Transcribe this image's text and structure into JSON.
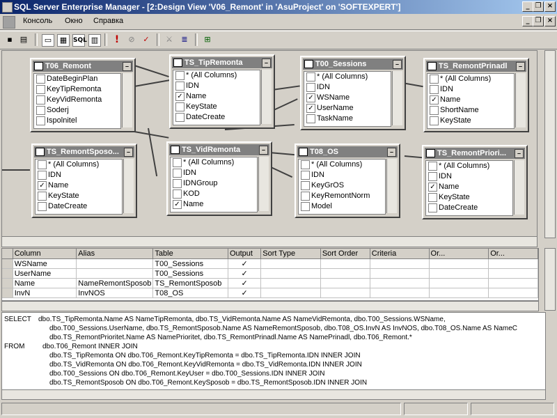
{
  "window": {
    "title": "SQL Server Enterprise Manager - [2:Design View 'V06_Remont' in 'AsuProject' on 'SOFTEXPERT']",
    "min_label": "_",
    "max_label": "❐",
    "close_label": "×"
  },
  "menu": {
    "items": [
      "Консоль",
      "Окно",
      "Справка"
    ]
  },
  "toolbar": {
    "sql_label": "SQL",
    "exclaim_label": "!"
  },
  "tables": [
    {
      "name": "T06_Remont",
      "rows": [
        {
          "label": "DateBeginPlan",
          "checked": false
        },
        {
          "label": "KeyTipRemonta",
          "checked": false
        },
        {
          "label": "KeyVidRemonta",
          "checked": false
        },
        {
          "label": "Soderj",
          "checked": false
        },
        {
          "label": "Ispolnitel",
          "checked": false
        }
      ]
    },
    {
      "name": "TS_TipRemonta",
      "rows": [
        {
          "label": "* (All Columns)",
          "checked": false
        },
        {
          "label": "IDN",
          "checked": false
        },
        {
          "label": "Name",
          "checked": true
        },
        {
          "label": "KeyState",
          "checked": false
        },
        {
          "label": "DateCreate",
          "checked": false
        }
      ]
    },
    {
      "name": "T00_Sessions",
      "rows": [
        {
          "label": "* (All Columns)",
          "checked": false
        },
        {
          "label": "IDN",
          "checked": false
        },
        {
          "label": "WSName",
          "checked": true
        },
        {
          "label": "UserName",
          "checked": true
        },
        {
          "label": "TaskName",
          "checked": false
        }
      ]
    },
    {
      "name": "TS_RemontPrinadl",
      "rows": [
        {
          "label": "* (All Columns)",
          "checked": false
        },
        {
          "label": "IDN",
          "checked": false
        },
        {
          "label": "Name",
          "checked": true
        },
        {
          "label": "ShortName",
          "checked": false
        },
        {
          "label": "KeyState",
          "checked": false
        }
      ]
    },
    {
      "name": "TS_RemontSposo...",
      "rows": [
        {
          "label": "* (All Columns)",
          "checked": false
        },
        {
          "label": "IDN",
          "checked": false
        },
        {
          "label": "Name",
          "checked": true
        },
        {
          "label": "KeyState",
          "checked": false
        },
        {
          "label": "DateCreate",
          "checked": false
        }
      ]
    },
    {
      "name": "TS_VidRemonta",
      "rows": [
        {
          "label": "* (All Columns)",
          "checked": false
        },
        {
          "label": "IDN",
          "checked": false
        },
        {
          "label": "IDNGroup",
          "checked": false
        },
        {
          "label": "KOD",
          "checked": false
        },
        {
          "label": "Name",
          "checked": true
        }
      ]
    },
    {
      "name": "T08_OS",
      "rows": [
        {
          "label": "* (All Columns)",
          "checked": false
        },
        {
          "label": "IDN",
          "checked": false
        },
        {
          "label": "KeyGrOS",
          "checked": false
        },
        {
          "label": "KeyRemontNorm",
          "checked": false
        },
        {
          "label": "Model",
          "checked": false
        }
      ]
    },
    {
      "name": "TS_RemontPriori...",
      "rows": [
        {
          "label": "* (All Columns)",
          "checked": false
        },
        {
          "label": "IDN",
          "checked": false
        },
        {
          "label": "Name",
          "checked": true
        },
        {
          "label": "KeyState",
          "checked": false
        },
        {
          "label": "DateCreate",
          "checked": false
        }
      ]
    }
  ],
  "grid": {
    "columns": [
      "Column",
      "Alias",
      "Table",
      "Output",
      "Sort Type",
      "Sort Order",
      "Criteria",
      "Or...",
      "Or..."
    ],
    "rows": [
      {
        "column": "WSName",
        "alias": "",
        "table": "T00_Sessions",
        "output": "✓"
      },
      {
        "column": "UserName",
        "alias": "",
        "table": "T00_Sessions",
        "output": "✓"
      },
      {
        "column": "Name",
        "alias": "NameRemontSposob",
        "table": "TS_RemontSposob",
        "output": "✓"
      },
      {
        "column": "InvN",
        "alias": "InvNOS",
        "table": "T08_OS",
        "output": "✓"
      }
    ]
  },
  "sql": {
    "select_kw": "SELECT",
    "from_kw": "FROM",
    "select_lines": [
      "dbo.TS_TipRemonta.Name AS NameTipRemonta, dbo.TS_VidRemonta.Name AS NameVidRemonta, dbo.T00_Sessions.WSName,",
      "dbo.T00_Sessions.UserName, dbo.TS_RemontSposob.Name AS NameRemontSposob, dbo.T08_OS.InvN AS InvNOS, dbo.T08_OS.Name AS NameC",
      "dbo.TS_RemontPrioritet.Name AS NamePrioritet, dbo.TS_RemontPrinadl.Name AS NamePrinadl, dbo.T06_Remont.*"
    ],
    "from_lines": [
      "dbo.T06_Remont INNER JOIN",
      "dbo.TS_TipRemonta ON dbo.T06_Remont.KeyTipRemonta = dbo.TS_TipRemonta.IDN INNER JOIN",
      "dbo.TS_VidRemonta ON dbo.T06_Remont.KeyVidRemonta = dbo.TS_VidRemonta.IDN INNER JOIN",
      "dbo.T00_Sessions ON dbo.T06_Remont.KeyUser = dbo.T00_Sessions.IDN INNER JOIN",
      "dbo.TS_RemontSposob ON dbo.T06_Remont.KeySposob = dbo.TS_RemontSposob.IDN INNER JOIN"
    ]
  }
}
